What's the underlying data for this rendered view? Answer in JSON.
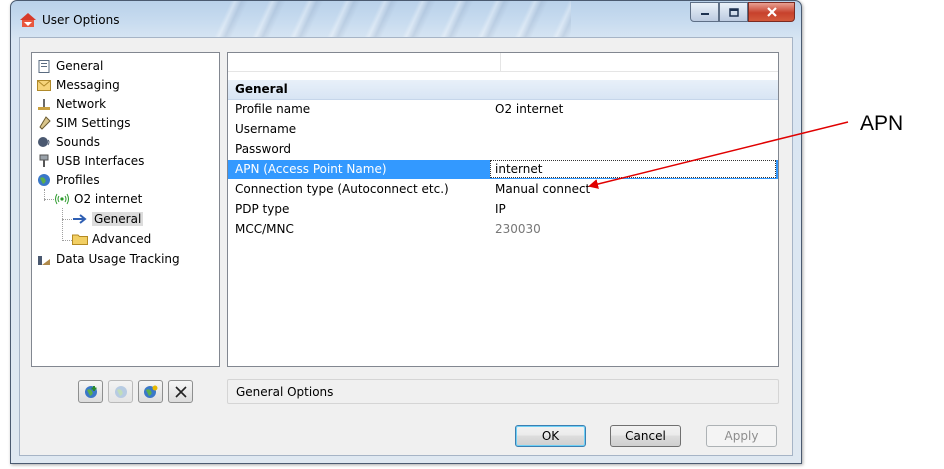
{
  "window": {
    "title": "User Options"
  },
  "tree": {
    "items": [
      {
        "label": "General",
        "icon": "general-page-icon"
      },
      {
        "label": "Messaging",
        "icon": "envelope-icon"
      },
      {
        "label": "Network",
        "icon": "network-icon"
      },
      {
        "label": "SIM Settings",
        "icon": "sim-card-icon"
      },
      {
        "label": "Sounds",
        "icon": "speaker-icon"
      },
      {
        "label": "USB Interfaces",
        "icon": "usb-icon"
      },
      {
        "label": "Profiles",
        "icon": "globe-icon"
      },
      {
        "label": "O2 internet",
        "icon": "antenna-icon"
      },
      {
        "label": "General",
        "icon": "arrow-right-icon"
      },
      {
        "label": "Advanced",
        "icon": "folder-icon"
      },
      {
        "label": "Data Usage Tracking",
        "icon": "chart-icon"
      }
    ]
  },
  "grid": {
    "section": "General",
    "rows": [
      {
        "key": "Profile name",
        "value": "O2 internet"
      },
      {
        "key": "Username",
        "value": ""
      },
      {
        "key": "Password",
        "value": ""
      },
      {
        "key": "APN (Access Point Name)",
        "value": "internet"
      },
      {
        "key": "Connection type (Autoconnect etc.)",
        "value": "Manual connect"
      },
      {
        "key": "PDP type",
        "value": "IP"
      },
      {
        "key": "MCC/MNC",
        "value": "230030"
      }
    ]
  },
  "status": "General Options",
  "buttons": {
    "ok": "OK",
    "cancel": "Cancel",
    "apply": "Apply"
  },
  "annotation": {
    "label": "APN",
    "arrow_color": "#e00000"
  }
}
